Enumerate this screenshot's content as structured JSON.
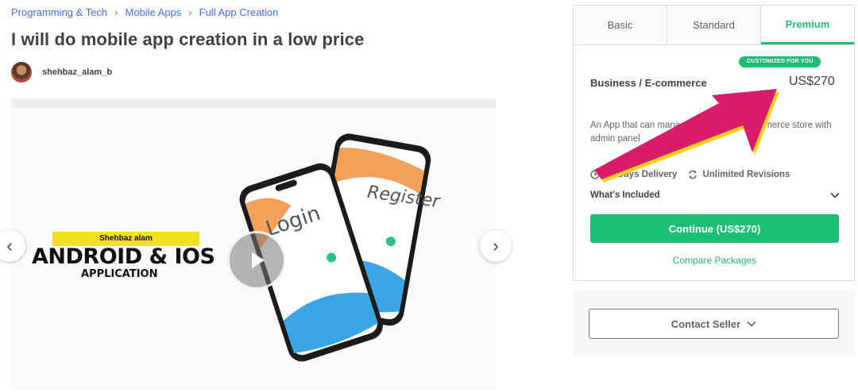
{
  "breadcrumb": {
    "items": [
      "Programming & Tech",
      "Mobile Apps",
      "Full App Creation"
    ]
  },
  "gig": {
    "title": "I will do mobile app creation in a low price"
  },
  "seller": {
    "username": "shehbaz_alam_b"
  },
  "gallery": {
    "promo_tag": "Shehbaz alam",
    "promo_main": "ANDROID & IOS",
    "promo_sub": "APPLICATION",
    "screen_login": "Login",
    "screen_register": "Register"
  },
  "package": {
    "tabs": [
      "Basic",
      "Standard",
      "Premium"
    ],
    "active_tab": "Premium",
    "badge": "CUSTOMIZED FOR YOU",
    "name": "Business / E-commerce",
    "price": "US$270",
    "description": "An App that can manage business or ecommerce store with admin panel",
    "delivery": "10 Days Delivery",
    "revisions": "Unlimited Revisions",
    "whats_included": "What's Included",
    "continue_label": "Continue (US$270)",
    "compare_label": "Compare Packages"
  },
  "contact": {
    "label": "Contact Seller"
  },
  "colors": {
    "brand_green": "#1dbf73",
    "link_blue": "#446ee7",
    "annotation_arrow": "#d81b6a",
    "annotation_arrow_shadow": "#f6d31a"
  },
  "icons": {
    "breadcrumb_separator": "chevron-right-icon",
    "gallery_prev": "chevron-left-icon",
    "gallery_next": "chevron-right-icon",
    "play": "play-icon",
    "delivery": "clock-icon",
    "revisions": "refresh-icon",
    "expand": "chevron-down-icon"
  }
}
